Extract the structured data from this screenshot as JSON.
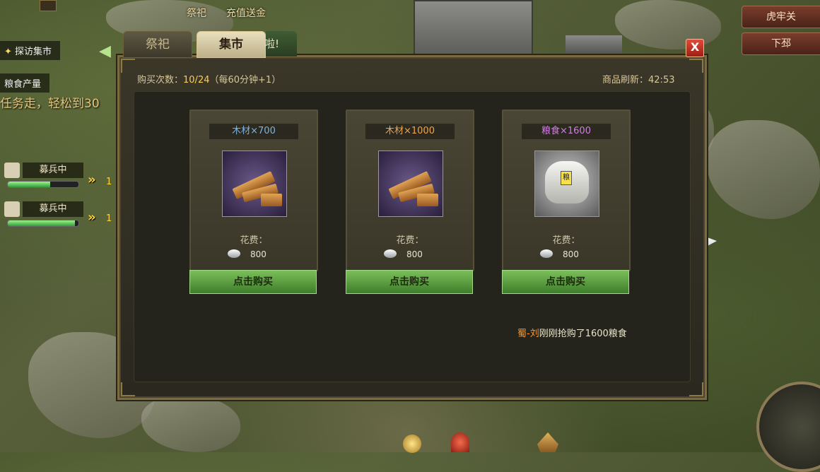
{
  "hud": {
    "top_buttons": [
      "祭祀",
      "充值送金"
    ],
    "side_labels": [
      "探访集市",
      "粮食产量"
    ],
    "task_text": "任务走，轻松到30",
    "recruit": [
      {
        "label": "募兵中",
        "progress": 0.6,
        "queue": "1"
      },
      {
        "label": "募兵中",
        "progress": 0.95,
        "queue": "1"
      }
    ],
    "right_buttons": [
      "虎牢关",
      "下邳"
    ]
  },
  "modal": {
    "tabs": [
      {
        "label": "祭祀",
        "active": false
      },
      {
        "label": "集市",
        "active": true
      }
    ],
    "partial_tab": "啦!",
    "close_label": "X",
    "purchase_info": {
      "label": "购买次数：",
      "value": "10/24",
      "note": "（每60分钟+1）"
    },
    "refresh": {
      "label": "商品刷新：",
      "value": "42:53"
    },
    "items": [
      {
        "name": "木材×700",
        "name_color": "#7db3e0",
        "icon": "wood-icon",
        "cost_label": "花费：",
        "cost": "800",
        "buy_label": "点击购买"
      },
      {
        "name": "木材×1000",
        "name_color": "#f0a54a",
        "icon": "wood-icon",
        "cost_label": "花费：",
        "cost": "800",
        "buy_label": "点击购买"
      },
      {
        "name": "粮食×1600",
        "name_color": "#d27be8",
        "icon": "rice-icon",
        "cost_label": "花费：",
        "cost": "800",
        "buy_label": "点击购买"
      }
    ],
    "feed": {
      "name": "蜀-刘",
      "text": "刚刚抢购了1600粮食"
    }
  }
}
